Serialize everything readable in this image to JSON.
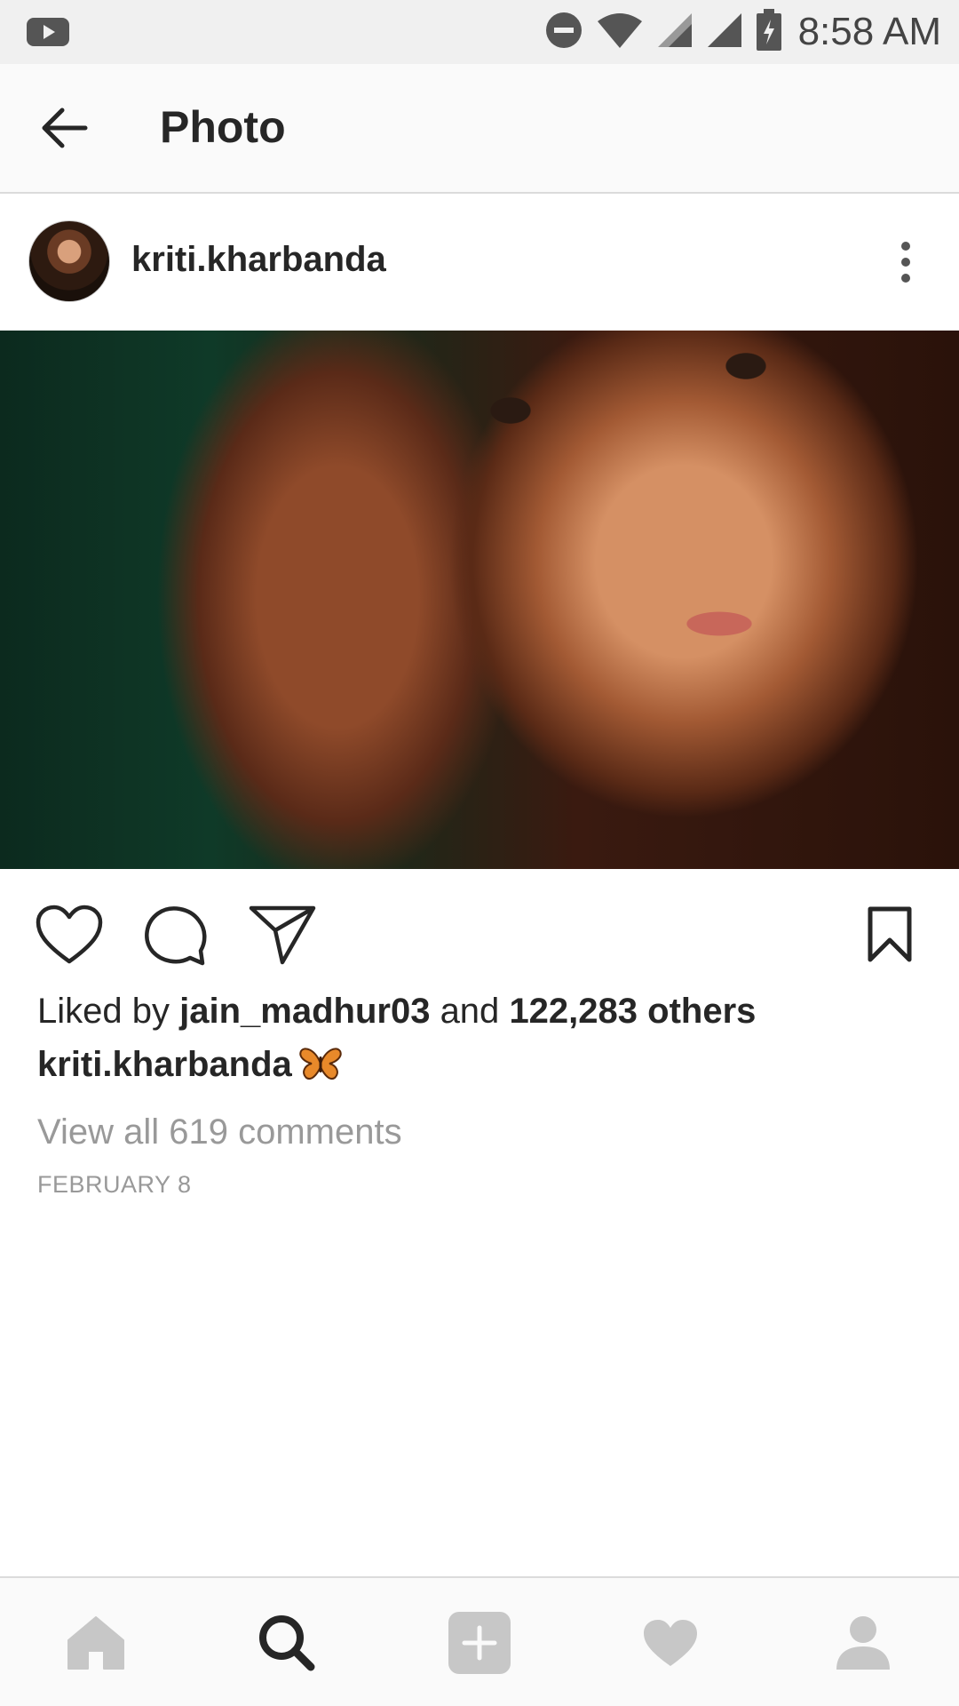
{
  "status_bar": {
    "time": "8:58 AM",
    "icons": [
      "youtube-icon",
      "do-not-disturb-icon",
      "wifi-icon",
      "signal-icon",
      "signal-icon",
      "battery-charging-icon"
    ]
  },
  "app_bar": {
    "title": "Photo",
    "back_icon": "arrow-left-icon"
  },
  "post": {
    "username": "kriti.kharbanda",
    "photo_alt": "portrait photo",
    "liked_by_prefix": "Liked by",
    "liked_by_user": "jain_madhur03",
    "liked_by_and": "and",
    "liked_by_others": "122,283 others",
    "caption_user": "kriti.kharbanda",
    "caption_emoji": "butterfly-icon",
    "view_comments": "View all 619 comments",
    "date": "FEBRUARY 8"
  },
  "bottom_nav": {
    "items": [
      "home-icon",
      "search-icon",
      "add-icon",
      "heart-icon",
      "profile-icon"
    ],
    "active": "search-icon"
  },
  "colors": {
    "text": "#262626",
    "muted": "#999999",
    "bar_bg": "#fafafa",
    "inactive_icon": "#c7c7c7"
  }
}
